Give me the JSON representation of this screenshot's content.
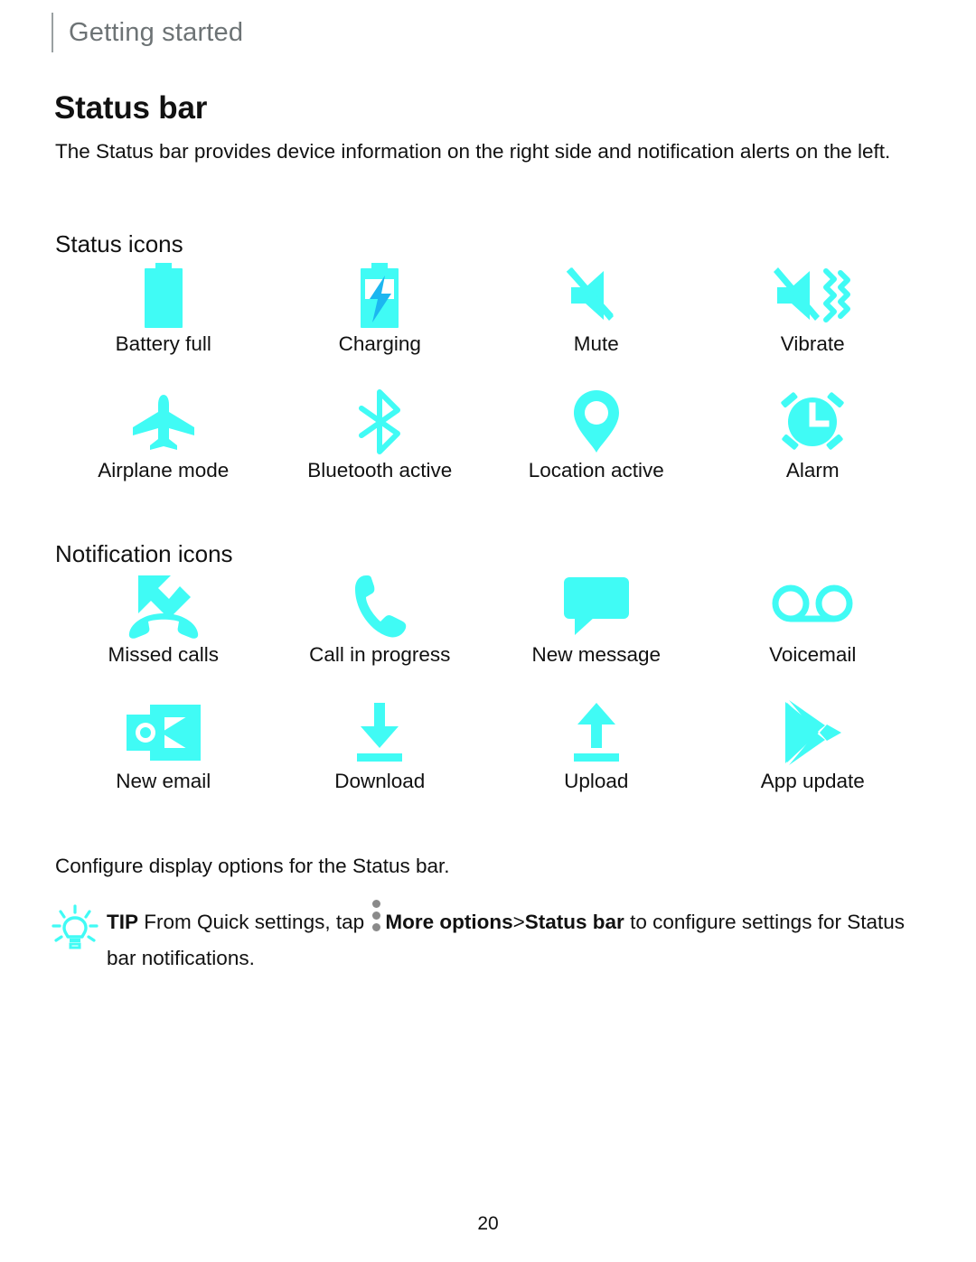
{
  "header": {
    "title": "Getting started"
  },
  "page_title": "Status bar",
  "intro": "The Status bar provides device information on the right side and notification alerts on the left.",
  "sections": {
    "status": {
      "heading": "Status icons",
      "icons": [
        {
          "label": "Battery full",
          "icon": "battery-full-icon"
        },
        {
          "label": "Charging",
          "icon": "battery-charging-icon"
        },
        {
          "label": "Mute",
          "icon": "mute-icon"
        },
        {
          "label": "Vibrate",
          "icon": "vibrate-icon"
        },
        {
          "label": "Airplane mode",
          "icon": "airplane-icon"
        },
        {
          "label": "Bluetooth active",
          "icon": "bluetooth-icon"
        },
        {
          "label": "Location active",
          "icon": "location-pin-icon"
        },
        {
          "label": "Alarm",
          "icon": "alarm-clock-icon"
        }
      ]
    },
    "notifications": {
      "heading": "Notification icons",
      "icons": [
        {
          "label": "Missed calls",
          "icon": "missed-call-icon"
        },
        {
          "label": "Call in progress",
          "icon": "phone-handset-icon"
        },
        {
          "label": "New message",
          "icon": "speech-bubble-icon"
        },
        {
          "label": "Voicemail",
          "icon": "voicemail-icon"
        },
        {
          "label": "New email",
          "icon": "outlook-mail-icon"
        },
        {
          "label": "Download",
          "icon": "download-arrow-icon"
        },
        {
          "label": "Upload",
          "icon": "upload-arrow-icon"
        },
        {
          "label": "App update",
          "icon": "play-store-icon"
        }
      ]
    }
  },
  "configure_line": "Configure display options for the Status bar.",
  "tip": {
    "icon": "lightbulb-icon",
    "label": "TIP",
    "text_before": "From Quick settings, tap",
    "kebab_icon": "more-options-kebab-icon",
    "bold_more_options": "More options",
    "separator": ">",
    "bold_status_bar": "Status bar",
    "text_after": "to configure settings for Status bar notifications."
  },
  "footer": {
    "page_number": "20"
  },
  "colors": {
    "accent_cyan": "#40FBF5",
    "charging_bolt_blue": "#1CB6F0",
    "header_gray": "#6D7375",
    "rule_gray": "#9AA0A2",
    "kebab_gray": "#8A8A8A",
    "text_black": "#111111"
  }
}
